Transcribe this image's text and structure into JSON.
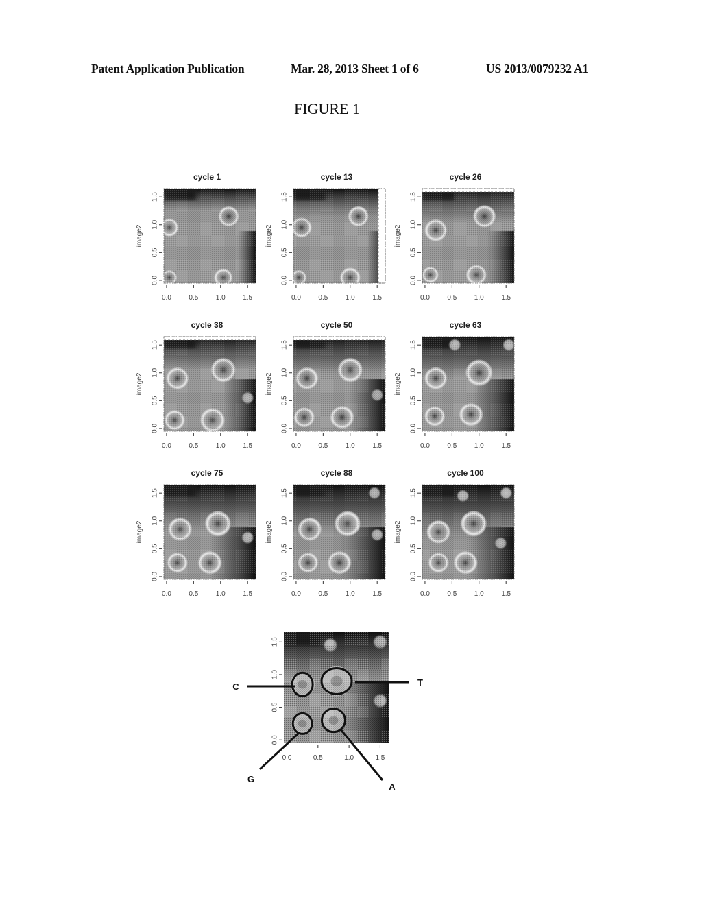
{
  "header": {
    "left": "Patent Application Publication",
    "middle": "Mar. 28, 2013  Sheet 1 of 6",
    "right": "US 2013/0079232 A1"
  },
  "figure_title": "FIGURE 1",
  "panels": [
    {
      "title": "cycle 1",
      "ylabel": "image2",
      "xticks": [
        "0.0",
        "0.5",
        "1.0",
        "1.5"
      ],
      "yticks": [
        "0.0",
        "0.5",
        "1.0",
        "1.5"
      ]
    },
    {
      "title": "cycle 13",
      "ylabel": "image2",
      "xticks": [
        "0.0",
        "0.5",
        "1.0",
        "1.5"
      ],
      "yticks": [
        "0.0",
        "0.5",
        "1.0",
        "1.5"
      ]
    },
    {
      "title": "cycle 26",
      "ylabel": "image2",
      "xticks": [
        "0.0",
        "0.5",
        "1.0",
        "1.5"
      ],
      "yticks": [
        "0.0",
        "0.5",
        "1.0",
        "1.5"
      ]
    },
    {
      "title": "cycle 38",
      "ylabel": "image2",
      "xticks": [
        "0.0",
        "0.5",
        "1.0",
        "1.5"
      ],
      "yticks": [
        "0.0",
        "0.5",
        "1.0",
        "1.5"
      ]
    },
    {
      "title": "cycle 50",
      "ylabel": "image2",
      "xticks": [
        "0.0",
        "0.5",
        "1.0",
        "1.5"
      ],
      "yticks": [
        "0.0",
        "0.5",
        "1.0",
        "1.5"
      ]
    },
    {
      "title": "cycle 63",
      "ylabel": "image2",
      "xticks": [
        "0.0",
        "0.5",
        "1.0",
        "1.5"
      ],
      "yticks": [
        "0.0",
        "0.5",
        "1.0",
        "1.5"
      ]
    },
    {
      "title": "cycle 75",
      "ylabel": "image2",
      "xticks": [
        "0.0",
        "0.5",
        "1.0",
        "1.5"
      ],
      "yticks": [
        "0.0",
        "0.5",
        "1.0",
        "1.5"
      ]
    },
    {
      "title": "cycle 88",
      "ylabel": "image2",
      "xticks": [
        "0.0",
        "0.5",
        "1.0",
        "1.5"
      ],
      "yticks": [
        "0.0",
        "0.5",
        "1.0",
        "1.5"
      ]
    },
    {
      "title": "cycle 100",
      "ylabel": "image2",
      "xticks": [
        "0.0",
        "0.5",
        "1.0",
        "1.5"
      ],
      "yticks": [
        "0.0",
        "0.5",
        "1.0",
        "1.5"
      ]
    }
  ],
  "annotated_panel": {
    "xticks": [
      "0.0",
      "0.5",
      "1.0",
      "1.5"
    ],
    "yticks": [
      "0.0",
      "0.5",
      "1.0",
      "1.5"
    ],
    "labels": {
      "C": "C",
      "T": "T",
      "G": "G",
      "A": "A"
    }
  },
  "chart_data": {
    "type": "heatmap",
    "title": "FIGURE 1",
    "panels": [
      "cycle 1",
      "cycle 13",
      "cycle 26",
      "cycle 38",
      "cycle 50",
      "cycle 63",
      "cycle 75",
      "cycle 88",
      "cycle 100"
    ],
    "xlabel": "",
    "ylabel": "image2",
    "xlim": [
      0,
      1.6
    ],
    "ylim": [
      0,
      1.6
    ],
    "xticks": [
      0.0,
      0.5,
      1.0,
      1.5
    ],
    "yticks": [
      0.0,
      0.5,
      1.0,
      1.5
    ],
    "annotated_clusters": [
      {
        "label": "C",
        "x": 0.25,
        "y": 0.85
      },
      {
        "label": "T",
        "x": 0.8,
        "y": 0.9
      },
      {
        "label": "G",
        "x": 0.25,
        "y": 0.25
      },
      {
        "label": "A",
        "x": 0.75,
        "y": 0.3
      }
    ]
  }
}
